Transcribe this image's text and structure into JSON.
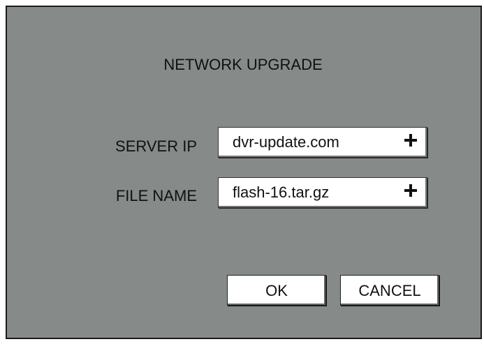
{
  "dialog": {
    "title": "NETWORK UPGRADE",
    "server_ip": {
      "label": "SERVER IP",
      "value": "dvr-update.com",
      "icon": "plus-icon"
    },
    "file_name": {
      "label": "FILE NAME",
      "value": "flash-16.tar.gz",
      "icon": "plus-icon"
    },
    "ok_label": "OK",
    "cancel_label": "CANCEL"
  },
  "colors": {
    "panel": "#868a89",
    "field": "#ffffff",
    "text": "#111111"
  }
}
